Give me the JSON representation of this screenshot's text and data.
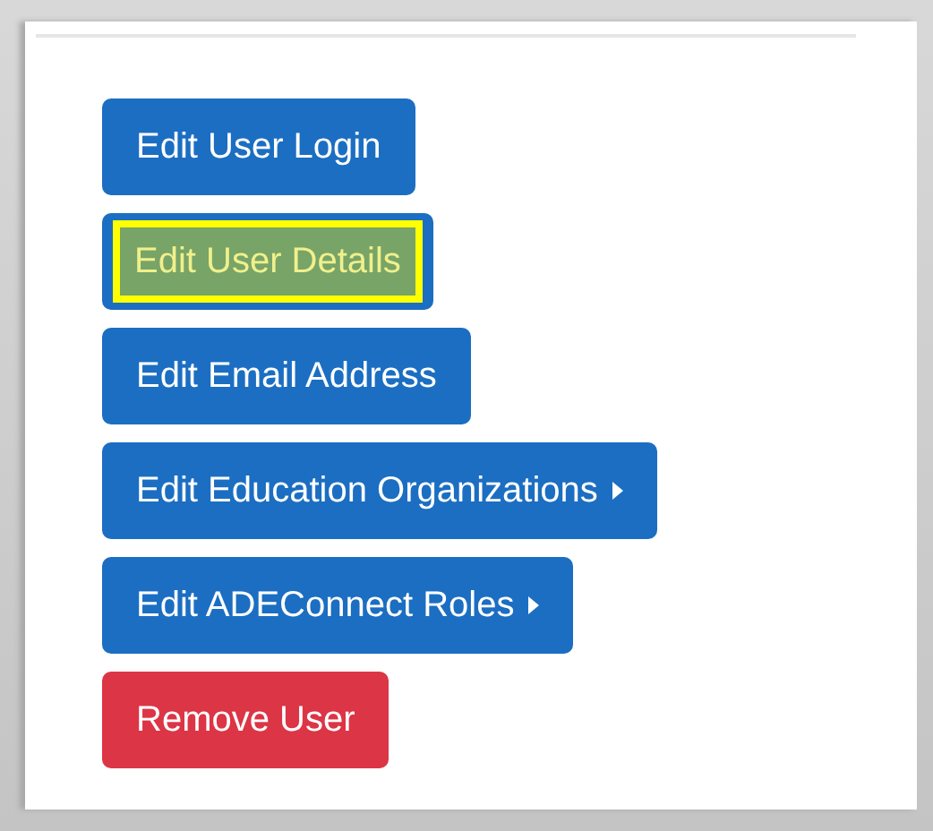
{
  "buttons": [
    {
      "label": "Edit User Login",
      "kind": "primary",
      "highlighted": false,
      "caret": false
    },
    {
      "label": "Edit User Details",
      "kind": "primary",
      "highlighted": true,
      "caret": false
    },
    {
      "label": "Edit Email Address",
      "kind": "primary",
      "highlighted": false,
      "caret": false
    },
    {
      "label": "Edit Education Organizations",
      "kind": "primary",
      "highlighted": false,
      "caret": true
    },
    {
      "label": "Edit ADEConnect Roles",
      "kind": "primary",
      "highlighted": false,
      "caret": true
    },
    {
      "label": "Remove User",
      "kind": "danger",
      "highlighted": false,
      "caret": false
    }
  ]
}
